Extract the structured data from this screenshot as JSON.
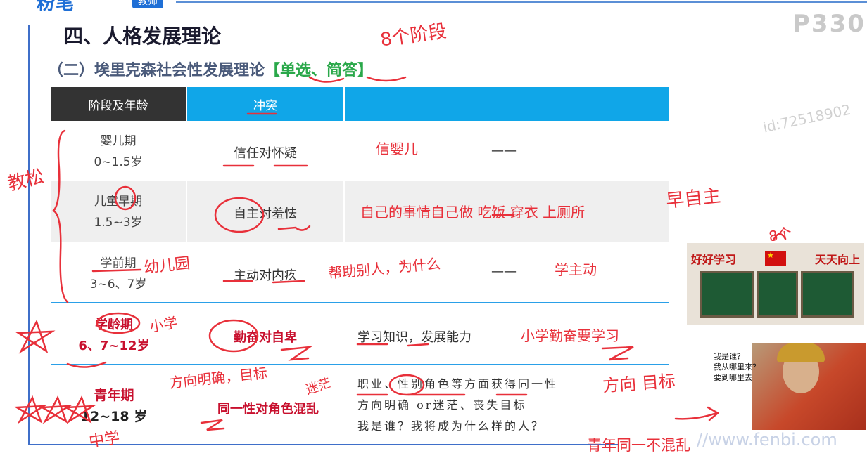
{
  "brand": {
    "logo": "粉笔",
    "tag": "教师"
  },
  "page_number": "P330",
  "watermark": "id:72518902",
  "title": "四、人格发展理论",
  "subtitle": {
    "text": "（二）埃里克森社会性发展理论",
    "tag": "【单选、简答】"
  },
  "table": {
    "headers": [
      "阶段及年龄",
      "冲突",
      ""
    ],
    "rows": [
      {
        "stage": "婴儿期",
        "age": "0~1.5岁",
        "conflict": "信任对怀疑",
        "desc": "信婴儿",
        "dash": "——"
      },
      {
        "stage": "儿童早期",
        "age": "1.5~3岁",
        "conflict": "自主对羞怯",
        "desc": "自己的事情自己做 吃饭 穿衣  上厕所"
      },
      {
        "stage": "学前期",
        "age": "3~6、7岁",
        "conflict": "主动对内疚",
        "dash": "——",
        "desc": "学主动"
      },
      {
        "stage": "学龄期",
        "age": "6、7~12岁",
        "conflict": "勤奋对自卑",
        "desc": "学习知识，发展能力",
        "desc_extra": "小学勤奋要学习"
      },
      {
        "stage": "青年期",
        "age": "12~18 岁",
        "conflict": "同一性对角色混乱",
        "desc_lines": [
          "职业、性别角色等方面获得同一性",
          "方向明确  or迷茫、丧失目标",
          "我是谁？我将成为什么样的人？"
        ]
      }
    ]
  },
  "handwritten_notes": {
    "stages_header": "8个阶段",
    "left_bracket": "教松",
    "early_child": "早自主",
    "kindergarten": "幼儿园",
    "help_others": "帮助别人，为什么",
    "primary": "小学",
    "direction": "方向明确，目标",
    "confused": "迷茫",
    "direction2": "方向 目标",
    "middle": "中学",
    "eight": "8个",
    "bottom_note": "青年同一不混乱"
  },
  "classroom_image": {
    "banner_left": "好好学习",
    "banner_right": "天天向上"
  },
  "speech_bubble": [
    "我是谁？",
    "我从哪里来？",
    "要到哪里去"
  ],
  "footer_url": "//www.fenbi.com",
  "colors": {
    "accent_blue": "#10a6e8",
    "header_dark": "#333333",
    "annotation_red": "#e8303a",
    "emphasis_red": "#c8102e",
    "tag_green": "#2aa84a"
  }
}
